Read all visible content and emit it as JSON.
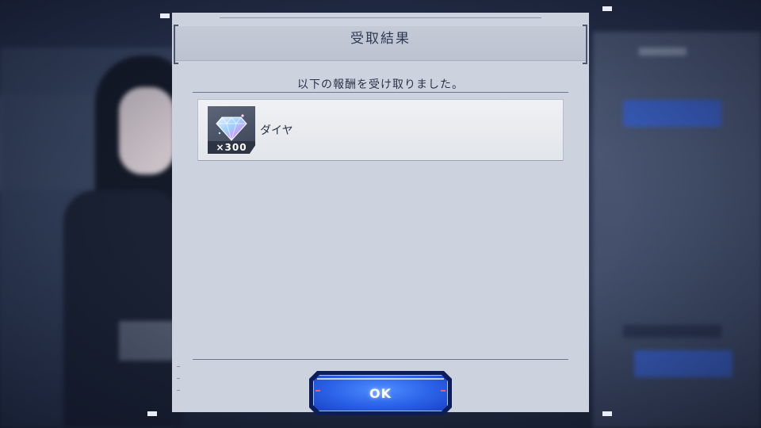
{
  "dialog": {
    "title": "受取結果",
    "message": "以下の報酬を受け取りました。"
  },
  "rewards": [
    {
      "name": "ダイヤ",
      "quantity": "×300",
      "icon": "diamond-gem-icon"
    }
  ],
  "actions": {
    "ok_label": "OK"
  },
  "colors": {
    "accent": "#2a62e8",
    "dialog_bg": "#cdd3de",
    "title_text": "#2e3a55"
  }
}
